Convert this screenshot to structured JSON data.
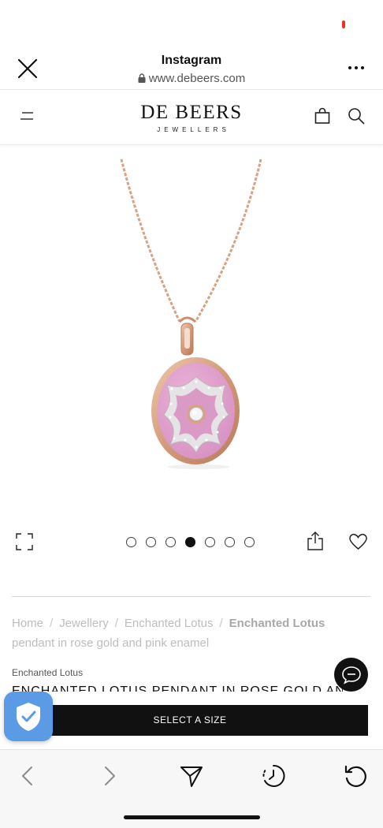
{
  "instagram_header": {
    "title": "Instagram",
    "url": "www.debeers.com"
  },
  "site_header": {
    "logo_main": "DE BEERS",
    "logo_sub": "JEWELLERS"
  },
  "gallery": {
    "slide_count": 7,
    "active_index": 3
  },
  "breadcrumb": {
    "items": [
      "Home",
      "Jewellery",
      "Enchanted Lotus"
    ],
    "current": "Enchanted Lotus",
    "current_rest": "pendant in rose gold and pink enamel"
  },
  "product": {
    "collection": "Enchanted Lotus",
    "title": "ENCHANTED LOTUS PENDANT IN ROSE GOLD AND PINK ENAMEL",
    "select_size_label": "SELECT A SIZE"
  },
  "colors": {
    "accent": "#111111",
    "enamel_pink": "#e2a6cf",
    "rose_gold": "#d9a282",
    "shield_blue": "#5b9be6",
    "recording_dot": "#e8322b"
  }
}
